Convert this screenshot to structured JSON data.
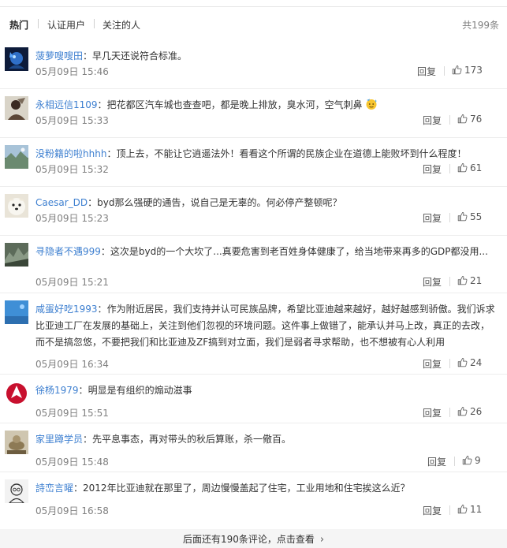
{
  "tabs": [
    {
      "label": "热门",
      "active": true
    },
    {
      "label": "认证用户",
      "active": false
    },
    {
      "label": "关注的人",
      "active": false
    }
  ],
  "total_count": "共199条",
  "reply_label": "回复",
  "comments": [
    {
      "user": "菠萝嗖嗖田",
      "separator": "：",
      "text": "早几天还说符合标准。",
      "time": "05月09日 15:46",
      "likes": "173"
    },
    {
      "user": "永相远信1109",
      "separator": "：",
      "text": "把花都区汽车城也查查吧，都是晚上排放，臭水河，空气刺鼻",
      "time": "05月09日 15:33",
      "likes": "76",
      "emoji": "sweat-face-icon"
    },
    {
      "user": "没粉籍的啦hhhh",
      "separator": "：",
      "text": "顶上去，不能让它逍遥法外！看看这个所谓的民族企业在道德上能败坏到什么程度！",
      "time": "05月09日 15:32",
      "likes": "61"
    },
    {
      "user": "Caesar_DD",
      "separator": "：",
      "text": "byd那么强硬的通告，说自己是无辜的。何必停产整顿呢？",
      "time": "05月09日 15:23",
      "likes": "55"
    },
    {
      "user": "寻隐者不遇999",
      "separator": "：",
      "text": "这次是byd的一个大坎了...真要危害到老百姓身体健康了，给当地带来再多的GDP都没用...",
      "time": "05月09日 15:21",
      "likes": "21"
    },
    {
      "user": "咸蛋好吃1993",
      "separator": "：",
      "text": "作为附近居民，我们支持并认可民族品牌，希望比亚迪越来越好，越好越感到骄傲。我们诉求比亚迪工厂在发展的基础上，关注到他们忽视的环境问题。这件事上做错了，能承认并马上改，真正的去改，而不是搞忽悠，不要把我们和比亚迪及ZF搞到对立面，我们是弱者寻求帮助，也不想被有心人利用",
      "time": "05月09日 16:34",
      "likes": "24"
    },
    {
      "user": "徐杨1979",
      "separator": "：",
      "text": "明显是有组织的煽动滋事",
      "time": "05月09日 15:51",
      "likes": "26"
    },
    {
      "user": "家里蹲学员",
      "separator": "：",
      "text": "先平息事态，再对带头的秋后算账，杀一儆百。",
      "time": "05月09日 15:48",
      "likes": "9"
    },
    {
      "user": "詩峦言曜",
      "separator": "：",
      "text": "2012年比亚迪就在那里了，周边慢慢盖起了住宅，工业用地和住宅挨这么近？",
      "time": "05月09日 16:58",
      "likes": "11"
    }
  ],
  "footer": {
    "label": "后面还有190条评论，点击查看"
  },
  "colors": {
    "username": "#3d7fd0",
    "meta": "#808080",
    "text": "#333333",
    "divider": "#ededed",
    "footer_bg": "#f5f5f5"
  },
  "icons": {
    "like": "thumbs-up-icon",
    "more": "chevron-right-icon"
  }
}
